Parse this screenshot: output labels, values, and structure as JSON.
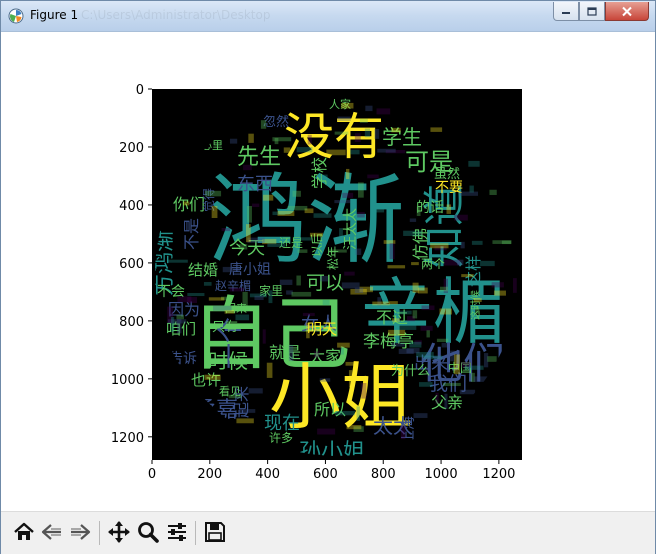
{
  "window": {
    "title": "Figure 1",
    "title_ghost": "C:\\Users\\Administrator\\Desktop"
  },
  "icons": {
    "app": "matplotlib-figure-icon",
    "minimize": "minimize-icon",
    "maximize": "maximize-icon",
    "close": "close-icon",
    "toolbar": [
      "home-icon",
      "back-arrow-icon",
      "forward-arrow-icon",
      "pan-move-icon",
      "zoom-magnifier-icon",
      "configure-subplots-icon",
      "save-disk-icon"
    ]
  },
  "colors": {
    "plot_background": "#000000",
    "palette": [
      "#fde725",
      "#5ec962",
      "#21918c",
      "#3b528b",
      "#440154"
    ]
  },
  "chart_data": {
    "type": "image",
    "xticks": [
      "0",
      "200",
      "400",
      "600",
      "800",
      "1000",
      "1200"
    ],
    "yticks": [
      "0",
      "200",
      "400",
      "600",
      "800",
      "1000",
      "1200"
    ],
    "xlim": [
      0,
      1280
    ],
    "ylim": [
      1280,
      0
    ],
    "words": [
      {
        "text": "鸿渐",
        "color": "#21918c"
      },
      {
        "text": "自己",
        "color": "#5ec962"
      },
      {
        "text": "小姐",
        "color": "#fde725"
      },
      {
        "text": "辛楣",
        "color": "#21918c"
      },
      {
        "text": "没有",
        "color": "#fde725"
      },
      {
        "text": "知道",
        "color": "#21918c"
      },
      {
        "text": "他们",
        "color": "#3b528b"
      },
      {
        "text": "孙小姐",
        "color": "#21918c"
      },
      {
        "text": "先生",
        "color": "#5ec962"
      },
      {
        "text": "可是",
        "color": "#5ec962"
      },
      {
        "text": "学生",
        "color": "#5ec962"
      },
      {
        "text": "李梅亭",
        "color": "#5ec962"
      },
      {
        "text": "方鸿渐",
        "color": "#21918c"
      },
      {
        "text": "一个",
        "color": "#3b528b"
      },
      {
        "text": "时候",
        "color": "#5ec962"
      },
      {
        "text": "我们",
        "color": "#3b528b"
      },
      {
        "text": "柔嘉",
        "color": "#3b528b"
      },
      {
        "text": "太太",
        "color": "#3b528b"
      },
      {
        "text": "女人",
        "color": "#3b528b"
      },
      {
        "text": "可以",
        "color": "#5ec962"
      },
      {
        "text": "今天",
        "color": "#5ec962"
      },
      {
        "text": "所以",
        "color": "#5ec962"
      },
      {
        "text": "就是",
        "color": "#5ec962"
      },
      {
        "text": "东西",
        "color": "#3b528b"
      },
      {
        "text": "学校",
        "color": "#5ec962"
      },
      {
        "text": "明天",
        "color": "#fde725"
      },
      {
        "text": "出来",
        "color": "#3b528b"
      },
      {
        "text": "你们",
        "color": "#5ec962"
      },
      {
        "text": "因为",
        "color": "#3b528b"
      },
      {
        "text": "咱们",
        "color": "#5ec962"
      },
      {
        "text": "现在",
        "color": "#21918c"
      },
      {
        "text": "大家",
        "color": "#5ec962"
      },
      {
        "text": "不过",
        "color": "#5ec962"
      },
      {
        "text": "也许",
        "color": "#5ec962"
      },
      {
        "text": "结婚",
        "color": "#5ec962"
      },
      {
        "text": "唐小姐",
        "color": "#3b528b"
      },
      {
        "text": "不会",
        "color": "#5ec962"
      },
      {
        "text": "父亲",
        "color": "#5ec962"
      },
      {
        "text": "为什么",
        "color": "#5ec962"
      },
      {
        "text": "仿佛",
        "color": "#5ec962"
      },
      {
        "text": "这样",
        "color": "#21918c"
      },
      {
        "text": "不是",
        "color": "#3b528b"
      },
      {
        "text": "起来",
        "color": "#3b528b"
      },
      {
        "text": "告诉",
        "color": "#3b528b"
      },
      {
        "text": "只有",
        "color": "#5ec962"
      },
      {
        "text": "忽然",
        "color": "#3b528b"
      },
      {
        "text": "人家",
        "color": "#5ec962"
      },
      {
        "text": "不要",
        "color": "#fde725"
      },
      {
        "text": "虽然",
        "color": "#5ec962"
      },
      {
        "text": "汪太太",
        "color": "#5ec962"
      },
      {
        "text": "上海",
        "color": "#3b528b"
      },
      {
        "text": "许多",
        "color": "#5ec962"
      },
      {
        "text": "中国",
        "color": "#5ec962"
      },
      {
        "text": "赵辛楣",
        "color": "#3b528b"
      },
      {
        "text": "的话",
        "color": "#5ec962"
      },
      {
        "text": "两个",
        "color": "#5ec962"
      },
      {
        "text": "还是",
        "color": "#5ec962"
      },
      {
        "text": "家里",
        "color": "#5ec962"
      },
      {
        "text": "以后",
        "color": "#5ec962"
      },
      {
        "text": "看见",
        "color": "#5ec962"
      },
      {
        "text": "觉得",
        "color": "#3b528b"
      },
      {
        "text": "心里",
        "color": "#5ec962"
      },
      {
        "text": "回来",
        "color": "#5ec962"
      },
      {
        "text": "松年",
        "color": "#5ec962"
      },
      {
        "text": "这时候",
        "color": "#5ec962"
      }
    ]
  }
}
